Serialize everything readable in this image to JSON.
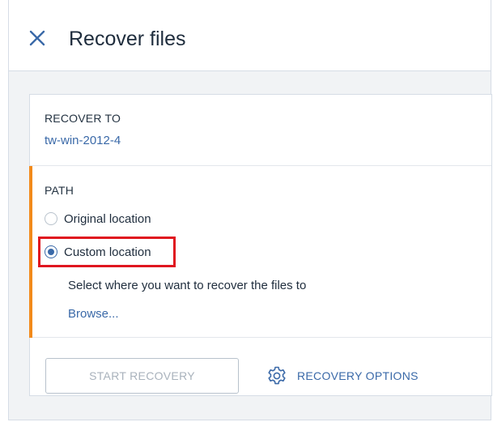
{
  "header": {
    "title": "Recover files",
    "close_icon": "close-icon"
  },
  "recover_to": {
    "label": "RECOVER TO",
    "target": "tw-win-2012-4"
  },
  "path": {
    "label": "PATH",
    "options": [
      {
        "label": "Original location",
        "selected": false
      },
      {
        "label": "Custom location",
        "selected": true
      }
    ],
    "helper": "Select where you want to recover the files to",
    "browse": "Browse..."
  },
  "actions": {
    "start_label": "START RECOVERY",
    "options_label": "RECOVERY OPTIONS",
    "options_icon": "gear-icon"
  },
  "colors": {
    "accent": "#f28a1b",
    "link": "#3a69a8",
    "highlight": "#e0161f"
  }
}
